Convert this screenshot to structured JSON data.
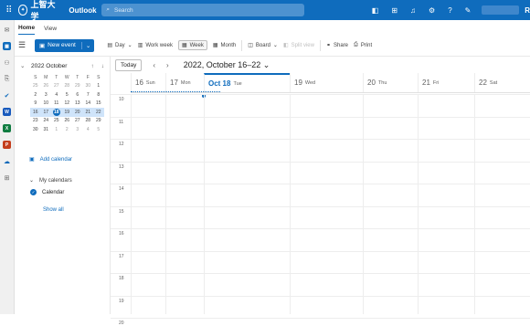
{
  "topbar": {
    "logo_text": "上智大学",
    "app_name": "Outlook",
    "search_placeholder": "Search",
    "avatar_initial": "R"
  },
  "tabs": [
    {
      "label": "Home",
      "active": true
    },
    {
      "label": "View",
      "active": false
    }
  ],
  "ribbon": {
    "new_event": "New event",
    "day": "Day",
    "work_week": "Work week",
    "week": "Week",
    "month": "Month",
    "board": "Board",
    "split_view": "Split view",
    "share": "Share",
    "print": "Print"
  },
  "mini_calendar": {
    "title": "2022 October",
    "weekdays": [
      "S",
      "M",
      "T",
      "W",
      "T",
      "F",
      "S"
    ],
    "weeks": [
      [
        "25",
        "26",
        "27",
        "28",
        "29",
        "30",
        "1"
      ],
      [
        "2",
        "3",
        "4",
        "5",
        "6",
        "7",
        "8"
      ],
      [
        "9",
        "10",
        "11",
        "12",
        "13",
        "14",
        "15"
      ],
      [
        "16",
        "17",
        "18",
        "19",
        "20",
        "21",
        "22"
      ],
      [
        "23",
        "24",
        "25",
        "26",
        "27",
        "28",
        "29"
      ],
      [
        "30",
        "31",
        "1",
        "2",
        "3",
        "4",
        "5"
      ]
    ],
    "selected_day": "18"
  },
  "sidebar": {
    "add_calendar": "Add calendar",
    "my_calendars": "My calendars",
    "calendar_item": "Calendar",
    "show_all": "Show all"
  },
  "calendar": {
    "today_button": "Today",
    "date_range": "2022, October 16–22",
    "days": [
      {
        "num": "16",
        "name": "Sun"
      },
      {
        "num": "17",
        "name": "Mon"
      },
      {
        "num": "Oct 18",
        "name": "Tue",
        "today": true
      },
      {
        "num": "19",
        "name": "Wed"
      },
      {
        "num": "20",
        "name": "Thu"
      },
      {
        "num": "21",
        "name": "Fri"
      },
      {
        "num": "22",
        "name": "Sat"
      }
    ],
    "hours": [
      "10",
      "11",
      "12",
      "13",
      "14",
      "15",
      "16",
      "17",
      "18",
      "19",
      "20"
    ]
  },
  "colors": {
    "brand_blue": "#0f6cbd",
    "week_highlight": "#cfe4fa"
  }
}
